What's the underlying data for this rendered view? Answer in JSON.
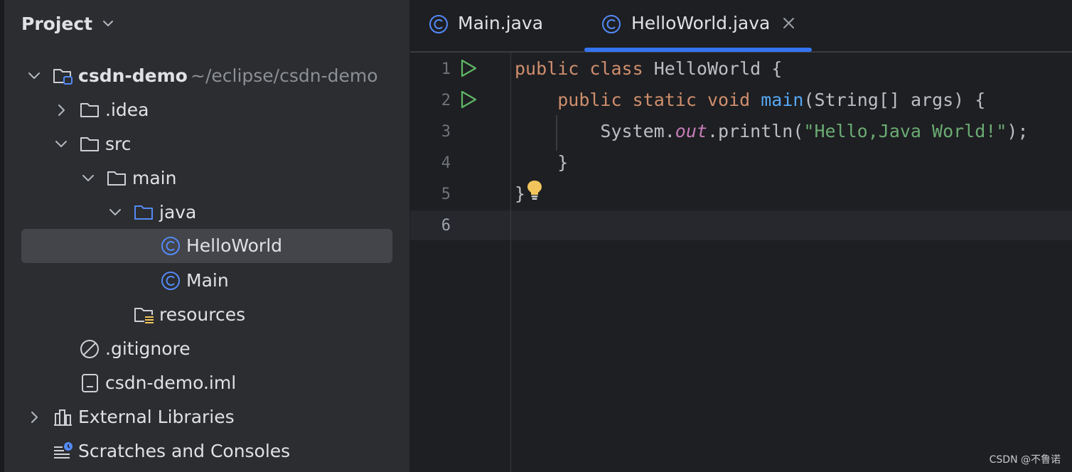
{
  "project_panel": {
    "title": "Project",
    "tree": [
      {
        "label": "csdn-demo",
        "hint": "~/eclipse/csdn-demo",
        "kind": "module",
        "expanded": true
      },
      {
        "label": ".idea",
        "kind": "folder",
        "expanded": false
      },
      {
        "label": "src",
        "kind": "folder",
        "expanded": true
      },
      {
        "label": "main",
        "kind": "folder",
        "expanded": true
      },
      {
        "label": "java",
        "kind": "source-folder",
        "expanded": true
      },
      {
        "label": "HelloWorld",
        "kind": "class",
        "selected": true
      },
      {
        "label": "Main",
        "kind": "class"
      },
      {
        "label": "resources",
        "kind": "resources-folder"
      },
      {
        "label": ".gitignore",
        "kind": "ignore-file"
      },
      {
        "label": "csdn-demo.iml",
        "kind": "iml-file"
      },
      {
        "label": "External Libraries",
        "kind": "libraries",
        "expanded": false
      },
      {
        "label": "Scratches and Consoles",
        "kind": "scratches"
      }
    ]
  },
  "editor": {
    "tabs": [
      {
        "label": "Main.java",
        "active": false
      },
      {
        "label": "HelloWorld.java",
        "active": true
      }
    ],
    "line_numbers": [
      "1",
      "2",
      "3",
      "4",
      "5",
      "6"
    ],
    "current_line": 6,
    "code": {
      "l1": {
        "kw_public": "public",
        "kw_class": "class",
        "name": " HelloWorld {"
      },
      "l2": {
        "indent": "    ",
        "kw_public": "public",
        "kw_static": "static",
        "kw_void": "void",
        "fn": "main",
        "rest": "(String[] args) {"
      },
      "l3": {
        "indent": "        ",
        "obj": "System.",
        "field": "out",
        "call": ".println(",
        "str": "\"Hello,Java World!\"",
        "end": ");"
      },
      "l4": {
        "text": "    }"
      },
      "l5": {
        "text": "}"
      }
    }
  },
  "watermark": "CSDN @不鲁诺",
  "colors": {
    "keyword": "#cf8e6d",
    "function": "#56a8f5",
    "static_field": "#c77dbb",
    "string": "#6aab73",
    "accent": "#3574f0",
    "class_icon": "#548af7",
    "run_icon": "#5fb865",
    "bulb": "#f2c55c"
  }
}
